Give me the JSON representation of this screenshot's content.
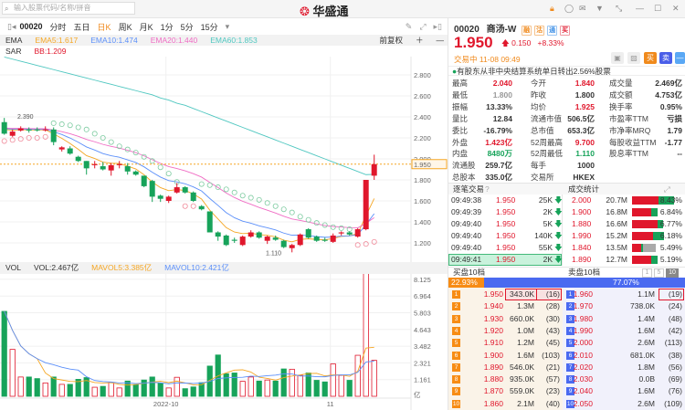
{
  "topbar": {
    "search_placeholder": "输入股票代码/名称/拼音",
    "logo": "华盛通"
  },
  "toolbar": {
    "code": "00020",
    "tabs": [
      "分时",
      "五日",
      "日K",
      "周K",
      "月K",
      "1分",
      "5分",
      "15分"
    ],
    "active": "日K"
  },
  "indicators": {
    "ema_name": "EMA",
    "ema5": "EMA5:1.617",
    "ema10": "EMA10:1.474",
    "ema20": "EMA20:1.440",
    "ema60": "EMA60:1.853",
    "adjust": "前复权",
    "sar_name": "SAR",
    "sar": "BB:1.209",
    "vol_name": "VOL",
    "vol": "VOL:2.467亿",
    "mavol5": "MAVOL5:3.385亿",
    "mavol10": "MAVOL10:2.421亿"
  },
  "colors": {
    "up": "#e0172c",
    "down": "#17a35a",
    "ema5": "#f5a623",
    "ema10": "#5b8ff9",
    "ema20": "#f06cc4",
    "ema60": "#4fc7c0",
    "accent": "#f08a1c"
  },
  "chart_data": {
    "type": "candlestick",
    "price_ticks": [
      "2.800",
      "2.600",
      "2.400",
      "2.200",
      "2.000",
      "1.800",
      "1.600",
      "1.400",
      "1.200"
    ],
    "price_range": [
      1.09,
      2.97
    ],
    "last_price": "1.950",
    "max_label": "2.390",
    "min_label": "1.110",
    "candles": [
      [
        2.35,
        2.39,
        2.23,
        2.24
      ],
      [
        2.22,
        2.28,
        2.21,
        2.26
      ],
      [
        2.27,
        2.31,
        2.26,
        2.29
      ],
      [
        2.28,
        2.3,
        2.25,
        2.27
      ],
      [
        2.28,
        2.3,
        2.26,
        2.275
      ],
      [
        2.28,
        2.31,
        2.26,
        2.28
      ],
      [
        2.28,
        2.3,
        2.13,
        2.16
      ],
      [
        2.09,
        2.12,
        2.07,
        2.11
      ],
      [
        2.1,
        2.12,
        2.04,
        2.05
      ],
      [
        2.02,
        2.03,
        1.97,
        1.98
      ],
      [
        1.98,
        1.98,
        1.85,
        1.91
      ],
      [
        1.94,
        1.98,
        1.91,
        1.95
      ],
      [
        1.93,
        1.97,
        1.89,
        1.9
      ],
      [
        1.89,
        1.96,
        1.84,
        1.94
      ],
      [
        1.94,
        1.98,
        1.91,
        1.95
      ],
      [
        1.93,
        1.96,
        1.85,
        1.88
      ],
      [
        1.88,
        1.89,
        1.84,
        1.85
      ],
      [
        1.84,
        1.84,
        1.73,
        1.74
      ],
      [
        1.79,
        1.8,
        1.59,
        1.64
      ],
      [
        1.65,
        1.66,
        1.59,
        1.62
      ],
      [
        1.6,
        1.65,
        1.58,
        1.64
      ],
      [
        1.68,
        1.77,
        1.67,
        1.73
      ],
      [
        1.73,
        1.74,
        1.67,
        1.68
      ],
      [
        1.68,
        1.69,
        1.59,
        1.6
      ],
      [
        1.55,
        1.56,
        1.51,
        1.52
      ],
      [
        1.5,
        1.5,
        1.3,
        1.3
      ],
      [
        1.3,
        1.31,
        1.22,
        1.26
      ],
      [
        1.27,
        1.28,
        1.17,
        1.18
      ],
      [
        1.23,
        1.25,
        1.2,
        1.22
      ],
      [
        1.18,
        1.27,
        1.17,
        1.26
      ],
      [
        1.26,
        1.32,
        1.25,
        1.3
      ],
      [
        1.3,
        1.31,
        1.24,
        1.25
      ],
      [
        1.22,
        1.27,
        1.19,
        1.26
      ],
      [
        1.25,
        1.27,
        1.22,
        1.23
      ],
      [
        1.22,
        1.23,
        1.15,
        1.16
      ],
      [
        1.15,
        1.19,
        1.11,
        1.18
      ],
      [
        1.18,
        1.29,
        1.17,
        1.28
      ],
      [
        1.33,
        1.34,
        1.24,
        1.25
      ],
      [
        1.26,
        1.27,
        1.21,
        1.22
      ],
      [
        1.23,
        1.25,
        1.21,
        1.22
      ],
      [
        1.21,
        1.29,
        1.2,
        1.27
      ],
      [
        1.29,
        1.31,
        1.27,
        1.3
      ],
      [
        1.3,
        1.31,
        1.27,
        1.28
      ],
      [
        1.26,
        1.34,
        1.25,
        1.33
      ],
      [
        1.33,
        1.8,
        1.32,
        1.8
      ],
      [
        1.84,
        2.04,
        1.8,
        1.95
      ]
    ],
    "ema60": [
      2.97,
      2.95,
      2.93,
      2.91,
      2.89,
      2.87,
      2.85,
      2.83,
      2.81,
      2.79,
      2.77,
      2.75,
      2.73,
      2.71,
      2.69,
      2.67,
      2.65,
      2.63,
      2.61,
      2.58,
      2.56,
      2.53,
      2.51,
      2.48,
      2.45,
      2.42,
      2.39,
      2.36,
      2.33,
      2.3,
      2.27,
      2.24,
      2.21,
      2.18,
      2.15,
      2.12,
      2.09,
      2.06,
      2.03,
      2.0,
      1.97,
      1.94,
      1.91,
      1.88,
      1.85,
      1.853
    ],
    "sar": [
      2.17,
      2.18,
      2.19,
      2.2,
      2.2,
      2.21,
      2.34,
      2.33,
      2.32,
      2.3,
      2.28,
      2.24,
      2.2,
      2.16,
      2.12,
      2.09,
      2.06,
      2.02,
      1.98,
      1.92,
      1.86,
      1.78,
      1.55,
      1.55,
      1.76,
      1.75,
      1.73,
      1.71,
      1.68,
      1.65,
      1.63,
      1.61,
      1.58,
      1.55,
      1.52,
      1.49,
      1.45,
      1.42,
      1.39,
      1.37,
      1.35,
      1.34,
      1.33,
      1.18,
      1.19,
      1.21
    ],
    "vol_ticks": [
      "8.125",
      "6.964",
      "5.803",
      "4.643",
      "3.482",
      "2.321",
      "1.161",
      "亿"
    ],
    "vol_max": 8.5,
    "volumes": [
      5.9,
      3.26,
      1.34,
      1.34,
      1.23,
      0.93,
      1.34,
      0.83,
      0.83,
      1.18,
      1.3,
      0.63,
      0.69,
      0.95,
      0.58,
      1.06,
      0.81,
      1.13,
      1.34,
      0.9,
      0.58,
      1.32,
      0.53,
      0.65,
      0.95,
      2.1,
      2.87,
      1.57,
      1.62,
      1.04,
      1.34,
      1.06,
      1.13,
      1.06,
      1.9,
      1.88,
      1.46,
      1.62,
      1.11,
      1.0,
      2.25,
      1.46,
      1.11,
      2.85,
      9.1,
      2.5
    ],
    "date_labels": [
      {
        "index": 20,
        "text": "2022-10"
      },
      {
        "index": 40,
        "text": "11"
      }
    ]
  },
  "quote": {
    "code": "00020",
    "name": "商汤-W",
    "badges": [
      "融",
      "沽",
      "通",
      "买"
    ],
    "price": "1.950",
    "change": "0.150",
    "pct": "+8.33%",
    "status": "交易中 11-08 09:49",
    "buy": "买",
    "sell": "卖",
    "notice": "有股东从非中央结算系统单日转出2.56%股票"
  },
  "stats": [
    [
      [
        "最高",
        "2.040",
        "red"
      ],
      [
        "今开",
        "1.840",
        "red"
      ],
      [
        "成交量",
        "2.469亿",
        ""
      ]
    ],
    [
      [
        "最低",
        "1.800",
        "gray"
      ],
      [
        "昨收",
        "1.800",
        ""
      ],
      [
        "成交额",
        "4.753亿",
        ""
      ]
    ],
    [
      [
        "振幅",
        "13.33%",
        ""
      ],
      [
        "均价",
        "1.925",
        "red"
      ],
      [
        "换手率",
        "0.95%",
        ""
      ]
    ],
    [
      [
        "量比",
        "12.84",
        ""
      ],
      [
        "流通市值",
        "506.5亿",
        ""
      ],
      [
        "市盈率TTM",
        "亏损",
        ""
      ]
    ],
    [
      [
        "委比",
        "-16.79%",
        ""
      ],
      [
        "总市值",
        "653.3亿",
        ""
      ],
      [
        "市净率MRQ",
        "1.79",
        ""
      ]
    ],
    [
      [
        "外盘",
        "1.423亿",
        "red"
      ],
      [
        "52周最高",
        "9.700",
        "red"
      ],
      [
        "每股收益TTM",
        "-1.77",
        ""
      ]
    ],
    [
      [
        "内盘",
        "8480万",
        "green"
      ],
      [
        "52周最低",
        "1.110",
        "green"
      ],
      [
        "股息率TTM",
        "--",
        ""
      ]
    ],
    [
      [
        "流通股",
        "259.7亿",
        ""
      ],
      [
        "每手",
        "1000",
        ""
      ]
    ],
    [
      [
        "总股本",
        "335.0亿",
        ""
      ],
      [
        "交易所",
        "HKEX",
        ""
      ]
    ]
  ],
  "trades": {
    "title": "逐笔交易",
    "stats_title": "成交统计",
    "rows": [
      {
        "time": "09:49:38",
        "price": "1.950",
        "vol": "25K"
      },
      {
        "time": "09:49:39",
        "price": "1.950",
        "vol": "2K"
      },
      {
        "time": "09:49:40",
        "price": "1.950",
        "vol": "5K"
      },
      {
        "time": "09:49:40",
        "price": "1.950",
        "vol": "140K"
      },
      {
        "time": "09:49:40",
        "price": "1.950",
        "vol": "55K"
      },
      {
        "time": "09:49:41",
        "price": "1.950",
        "vol": "2K"
      }
    ],
    "stats": [
      {
        "price": "2.000",
        "vol": "20.7M",
        "pct": "8.43%",
        "red": 0.62,
        "green": 0.38
      },
      {
        "price": "1.900",
        "vol": "16.8M",
        "pct": "6.84%",
        "red": 0.45,
        "green": 0.15
      },
      {
        "price": "1.880",
        "vol": "16.6M",
        "pct": "6.77%",
        "red": 0.6,
        "green": 0.15
      },
      {
        "price": "1.990",
        "vol": "15.2M",
        "pct": "6.18%",
        "red": 0.5,
        "green": 0.25
      },
      {
        "price": "1.840",
        "vol": "13.5M",
        "pct": "5.49%",
        "red": 0.22,
        "green": 0.05,
        "gray": 0.3
      },
      {
        "price": "1.890",
        "vol": "12.7M",
        "pct": "5.19%",
        "red": 0.45,
        "green": 0.15
      }
    ]
  },
  "orderbook": {
    "bid_title": "买盘10档",
    "ask_title": "卖盘10档",
    "levels": [
      "1",
      "5",
      "10"
    ],
    "bid_pct": "22.93%",
    "ask_pct": "77.07%",
    "bid_frac": 0.2293,
    "bids": [
      [
        "1",
        "1.950",
        "343.0K",
        "(16)"
      ],
      [
        "2",
        "1.940",
        "1.3M",
        "(28)"
      ],
      [
        "3",
        "1.930",
        "660.0K",
        "(30)"
      ],
      [
        "4",
        "1.920",
        "1.0M",
        "(43)"
      ],
      [
        "5",
        "1.910",
        "1.2M",
        "(45)"
      ],
      [
        "6",
        "1.900",
        "1.6M",
        "(103)"
      ],
      [
        "7",
        "1.890",
        "546.0K",
        "(21)"
      ],
      [
        "8",
        "1.880",
        "935.0K",
        "(57)"
      ],
      [
        "9",
        "1.870",
        "559.0K",
        "(23)"
      ],
      [
        "10",
        "1.860",
        "2.1M",
        "(40)"
      ]
    ],
    "asks": [
      [
        "1",
        "1.960",
        "1.1M",
        "(19)"
      ],
      [
        "2",
        "1.970",
        "738.0K",
        "(24)"
      ],
      [
        "3",
        "1.980",
        "1.4M",
        "(48)"
      ],
      [
        "4",
        "1.990",
        "1.6M",
        "(42)"
      ],
      [
        "5",
        "2.000",
        "2.6M",
        "(113)"
      ],
      [
        "6",
        "2.010",
        "681.0K",
        "(38)"
      ],
      [
        "7",
        "2.020",
        "1.8M",
        "(56)"
      ],
      [
        "8",
        "2.030",
        "0.0B",
        "(69)"
      ],
      [
        "9",
        "2.040",
        "1.6M",
        "(76)"
      ],
      [
        "10",
        "2.050",
        "2.6M",
        "(109)"
      ]
    ]
  }
}
